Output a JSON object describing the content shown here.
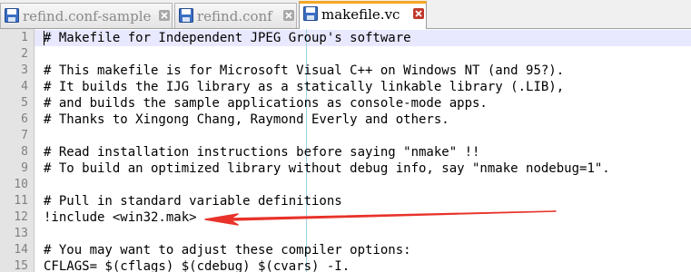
{
  "tabs": [
    {
      "label": "refind.conf-sample",
      "active": false,
      "icon": "save-icon"
    },
    {
      "label": "refind.conf",
      "active": false,
      "icon": "save-icon"
    },
    {
      "label": "makefile.vc",
      "active": true,
      "icon": "save-icon"
    }
  ],
  "editor": {
    "lines": [
      {
        "n": "1",
        "text": "# Makefile for Independent JPEG Group's software"
      },
      {
        "n": "2",
        "text": ""
      },
      {
        "n": "3",
        "text": "# This makefile is for Microsoft Visual C++ on Windows NT (and 95?)."
      },
      {
        "n": "4",
        "text": "# It builds the IJG library as a statically linkable library (.LIB),"
      },
      {
        "n": "5",
        "text": "# and builds the sample applications as console-mode apps."
      },
      {
        "n": "6",
        "text": "# Thanks to Xingong Chang, Raymond Everly and others."
      },
      {
        "n": "7",
        "text": ""
      },
      {
        "n": "8",
        "text": "# Read installation instructions before saying \"nmake\" !!"
      },
      {
        "n": "9",
        "text": "# To build an optimized library without debug info, say \"nmake nodebug=1\"."
      },
      {
        "n": "10",
        "text": ""
      },
      {
        "n": "11",
        "text": "# Pull in standard variable definitions"
      },
      {
        "n": "12",
        "text": "!include <win32.mak>"
      },
      {
        "n": "13",
        "text": ""
      },
      {
        "n": "14",
        "text": "# You may want to adjust these compiler options:"
      },
      {
        "n": "15",
        "text": "CFLAGS= $(cflags) $(cdebug) $(cvars) -I."
      }
    ]
  },
  "annotation": {
    "color": "#e8322a",
    "points_to_line": "12"
  },
  "colors": {
    "active_tab_accent": "#f5a623",
    "current_line": "#e8e8ff",
    "gutter": "#e4e4e4",
    "edge_line": "#9ad4e8"
  }
}
